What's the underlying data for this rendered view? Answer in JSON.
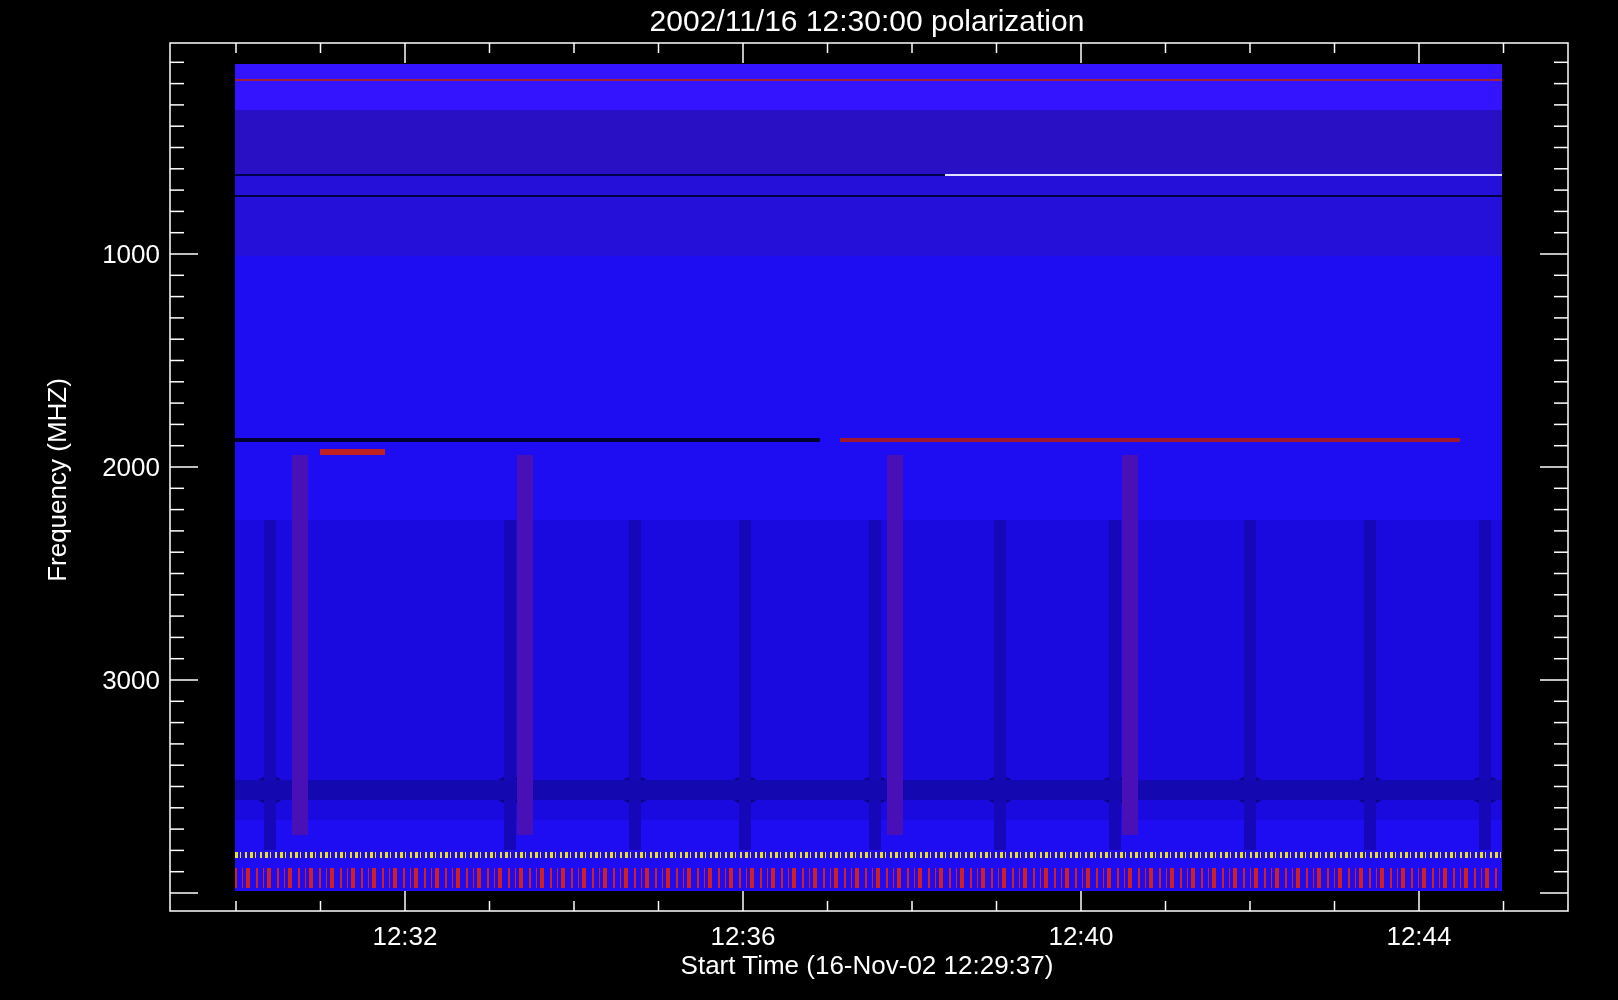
{
  "title": "2002/11/16 12:30:00 polarization",
  "x_axis": {
    "label": "Start Time (16-Nov-02 12:29:37)",
    "ticks": [
      "12:32",
      "12:36",
      "12:40",
      "12:44"
    ]
  },
  "y_axis": {
    "label": "Frequency (MHZ)",
    "ticks": [
      "1000",
      "2000",
      "3000"
    ]
  }
}
